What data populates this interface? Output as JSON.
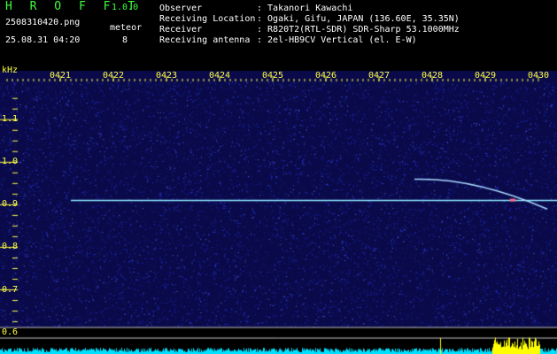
{
  "header": {
    "app_name": "H R O F F T",
    "app_version": "1.0.0",
    "file_name": "2508310420.png",
    "meteor_label": "meteor",
    "datetime": "25.08.31 04:20",
    "meteor_count": "8",
    "info": [
      {
        "key": "Observer",
        "value": ": Takanori Kawachi"
      },
      {
        "key": "Receiving Location",
        "value": ": Ogaki, Gifu, JAPAN (136.60E, 35.35N)"
      },
      {
        "key": "Receiver",
        "value": ": R820T2(RTL-SDR) SDR-Sharp 53.1000MHz"
      },
      {
        "key": "Receiving antenna",
        "value": ": 2el-HB9CV Vertical (el. E-W)"
      }
    ]
  },
  "chart_data": {
    "type": "heatmap",
    "ylabel": "kHz",
    "x_ticks": [
      "0421",
      "0422",
      "0423",
      "0424",
      "0425",
      "0426",
      "0427",
      "0428",
      "0429",
      "0430"
    ],
    "y_ticks": [
      "1.1",
      "1.0",
      "0.9",
      "0.8",
      "0.7",
      "0.6"
    ],
    "y_range": [
      0.57,
      1.19
    ],
    "carrier_khz": 0.91,
    "meteor_trace": {
      "start_time": "0428",
      "start_khz": 0.96,
      "end_time": "0430",
      "end_khz": 0.89
    },
    "colors": {
      "background": "#0a0a4a",
      "noise": "#2a3cff",
      "carrier": "#8fe8ff",
      "level_bar": "#00e0ff",
      "level_peak": "#ffff00"
    }
  }
}
